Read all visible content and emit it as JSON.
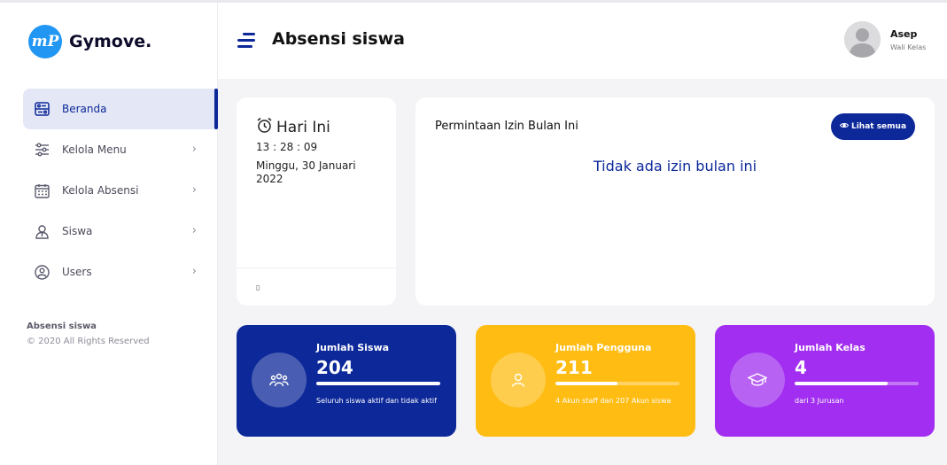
{
  "brand": {
    "logo_mark": "mP",
    "name": "Gymove."
  },
  "sidebar": {
    "items": [
      {
        "label": "Beranda",
        "icon": "dashboard-icon",
        "active": true
      },
      {
        "label": "Kelola Menu",
        "icon": "sliders-icon",
        "active": false
      },
      {
        "label": "Kelola Absensi",
        "icon": "calendar-icon",
        "active": false
      },
      {
        "label": "Siswa",
        "icon": "student-icon",
        "active": false
      },
      {
        "label": "Users",
        "icon": "users-icon",
        "active": false
      }
    ],
    "footer_title": "Absensi siswa",
    "footer_copy": "© 2020 All Rights Reserved"
  },
  "header": {
    "title": "Absensi siswa",
    "user_name": "Asep",
    "user_role": "Wali Kelas"
  },
  "today": {
    "title": "Hari Ini",
    "time": "13 : 28 : 09",
    "date": "Minggu, 30 Januari 2022",
    "footer_glyph": "▯"
  },
  "izin": {
    "title": "Permintaan Izin Bulan Ini",
    "see_all_label": "Lihat semua",
    "empty_message": "Tidak ada izin bulan ini"
  },
  "stats": {
    "students": {
      "label": "Jumlah Siswa",
      "value": "204",
      "note": "Seluruh siswa aktif dan tidak aktif",
      "progress": 1.0,
      "color": "#0c2899"
    },
    "users": {
      "label": "Jumlah Pengguna",
      "value": "211",
      "note": "4 Akun staff dan 207 Akun siswa",
      "progress": 0.5,
      "color": "#ffbc12"
    },
    "classes": {
      "label": "Jumlah Kelas",
      "value": "4",
      "note": "dari 3 Jurusan",
      "progress": 0.75,
      "color": "#a12ef0"
    }
  },
  "colors": {
    "primary": "#0c2899",
    "active_bg": "#e4e7f5"
  }
}
